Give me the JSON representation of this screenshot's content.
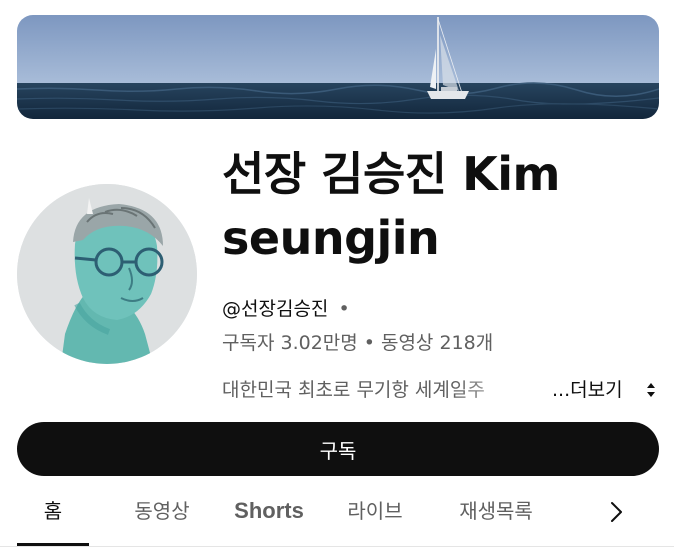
{
  "channel": {
    "name": "선장 김승진 Kim seungjin",
    "handle": "@선장김승진",
    "handle_separator": "•",
    "subscribers": "구독자 3.02만명",
    "stats_separator": "•",
    "videos": "동영상 218개",
    "description": "대한민국 최초로 무기항 세계일주",
    "more_label": "...더보기"
  },
  "subscribe_label": "구독",
  "tabs": [
    {
      "label": "홈",
      "active": true
    },
    {
      "label": "동영상",
      "active": false
    },
    {
      "label": "Shorts",
      "active": false
    },
    {
      "label": "라이브",
      "active": false
    },
    {
      "label": "재생목록",
      "active": false
    }
  ],
  "icons": {
    "next_tabs": "chevron-right-icon",
    "more": "expand-arrows-icon"
  },
  "colors": {
    "text_primary": "#0f0f0f",
    "text_secondary": "#606060",
    "button_bg": "#0f0f0f",
    "button_text": "#ffffff",
    "sky": "#8ea7cc",
    "sea": "#1d3550"
  }
}
